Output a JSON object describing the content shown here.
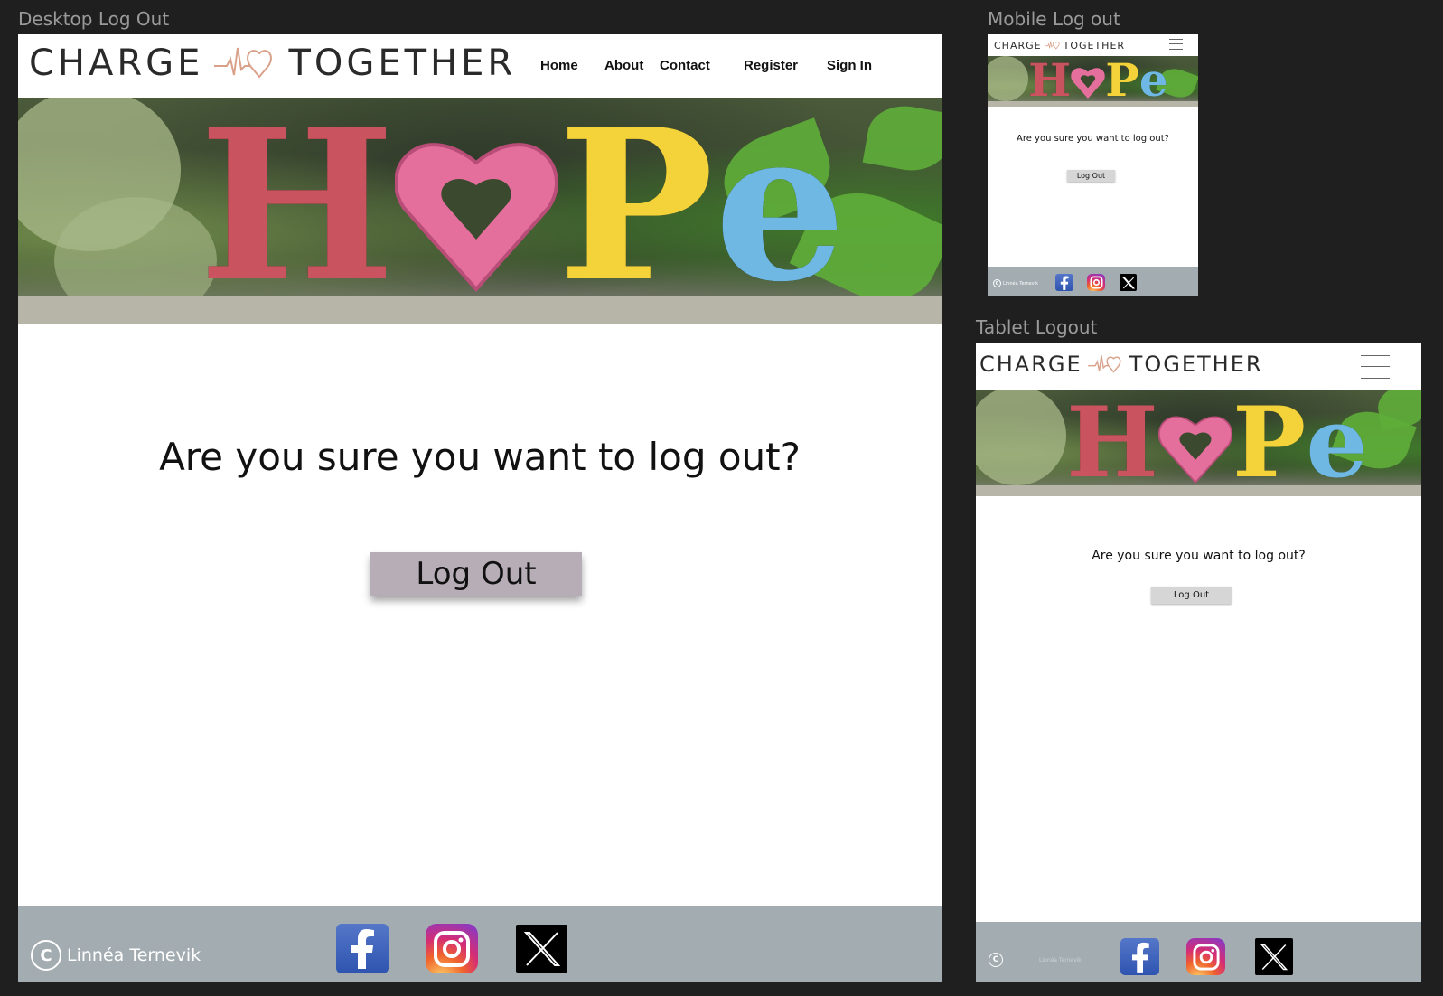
{
  "brand": {
    "word1": "CHARGE",
    "word2": "TOGETHER",
    "accent": "#d9a18a"
  },
  "labels": {
    "desktop": "Desktop Log Out",
    "mobile": "Mobile Log out",
    "tablet": "Tablet Logout"
  },
  "nav": [
    "Home",
    "About",
    "Contact",
    "Register",
    "Sign In"
  ],
  "hero": {
    "letters": [
      "H",
      "P",
      "e"
    ]
  },
  "content": {
    "question": "Are you sure you want to log out?",
    "button": "Log Out"
  },
  "footer": {
    "copyright": "Linnéa Ternevik",
    "copyright_symbol": "C"
  },
  "colors": {
    "footer": "#a3adb1",
    "button_desktop": "#b7adb7",
    "button_small": "#d6d6d6"
  },
  "icons": {
    "facebook": "facebook-icon",
    "instagram": "instagram-icon",
    "x": "x-icon",
    "menu": "hamburger-menu-icon"
  }
}
